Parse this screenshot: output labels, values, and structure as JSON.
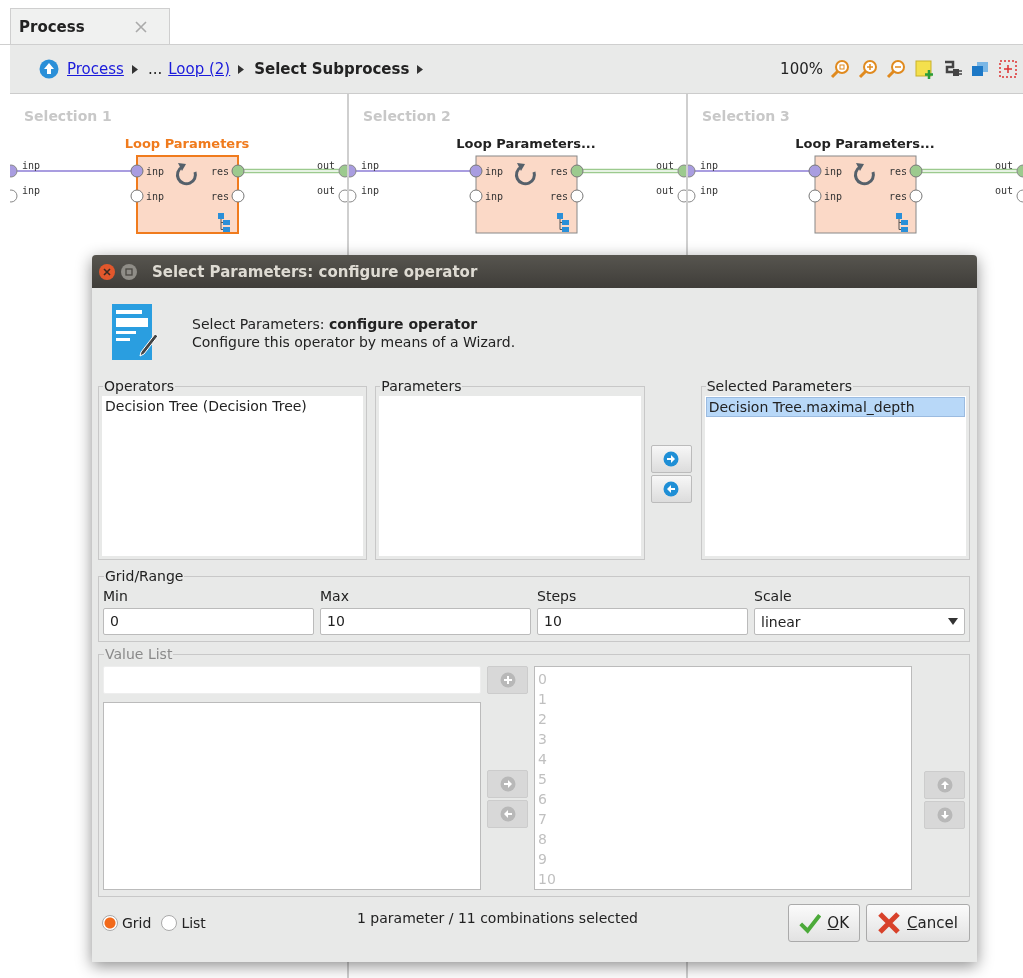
{
  "tab": {
    "label": "Process",
    "selected": true
  },
  "breadcrumb": [
    {
      "label": "Process",
      "kind": "link"
    },
    {
      "label": "...",
      "kind": "text"
    },
    {
      "label": "Loop (2)",
      "kind": "link"
    },
    {
      "label": "Select Subprocess",
      "kind": "current"
    }
  ],
  "zoom": "100%",
  "panels": [
    {
      "title": "Selection 1",
      "operator": {
        "name": "Loop Parameters",
        "selected": true,
        "inputs": [
          "inp",
          "inp"
        ],
        "outputs": [
          "res",
          "res"
        ]
      },
      "left_ports": [
        {
          "label": "inp",
          "connected": true
        },
        {
          "label": "inp",
          "connected": false
        }
      ],
      "right_ports": [
        {
          "label": "out",
          "connected": true
        },
        {
          "label": "out",
          "connected": false
        }
      ]
    },
    {
      "title": "Selection 2",
      "operator": {
        "name": "Loop Parameters...",
        "selected": false,
        "inputs": [
          "inp",
          "inp"
        ],
        "outputs": [
          "res",
          "res"
        ]
      },
      "left_ports": [
        {
          "label": "inp",
          "connected": true
        },
        {
          "label": "inp",
          "connected": false
        }
      ],
      "right_ports": [
        {
          "label": "out",
          "connected": true
        },
        {
          "label": "out",
          "connected": false
        }
      ]
    },
    {
      "title": "Selection 3",
      "operator": {
        "name": "Loop Parameters...",
        "selected": false,
        "inputs": [
          "inp",
          "inp"
        ],
        "outputs": [
          "res",
          "res"
        ]
      },
      "left_ports": [
        {
          "label": "inp",
          "connected": true
        },
        {
          "label": "inp",
          "connected": false
        }
      ],
      "right_ports": [
        {
          "label": "out",
          "connected": true
        },
        {
          "label": "out",
          "connected": false
        }
      ]
    }
  ],
  "dialog": {
    "title": "Select Parameters: configure operator",
    "heading": "Select Parameters: **configure operator**",
    "subtitle": "Configure this operator by means of a Wizard.",
    "operators": {
      "label": "Operators",
      "items": [
        {
          "label": "Decision Tree (Decision Tree)",
          "selected": false
        }
      ]
    },
    "parameters": {
      "label": "Parameters"
    },
    "selected_parameters": {
      "label": "Selected Parameters",
      "items": [
        {
          "label": "Decision Tree.maximal_depth",
          "selected": true
        }
      ]
    },
    "grid_range": {
      "label": "Grid/Range",
      "fields": [
        {
          "label": "Min",
          "value": "0"
        },
        {
          "label": "Max",
          "value": "10"
        },
        {
          "label": "Steps",
          "value": "10"
        }
      ],
      "scale": {
        "label": "Scale",
        "value": "linear"
      }
    },
    "value_list": {
      "label": "Value List",
      "disabled": true,
      "values": [
        "0",
        "1",
        "2",
        "3",
        "4",
        "5",
        "6",
        "7",
        "8",
        "9",
        "10"
      ]
    },
    "modes": [
      {
        "label": "Grid",
        "selected": true
      },
      {
        "label": "List",
        "selected": false
      }
    ],
    "status": "1 parameter / 11 combinations selected",
    "buttons": [
      {
        "label": "OK",
        "kind": "ok"
      },
      {
        "label": "Cancel",
        "kind": "cancel"
      }
    ]
  }
}
